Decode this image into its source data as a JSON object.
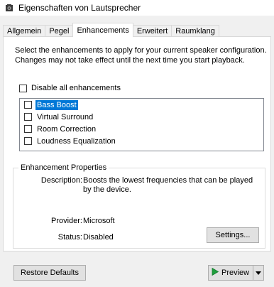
{
  "window": {
    "title": "Eigenschaften von Lautsprecher",
    "icon": "speaker-icon"
  },
  "tabs": [
    {
      "label": "Allgemein",
      "active": false
    },
    {
      "label": "Pegel",
      "active": false
    },
    {
      "label": "Enhancements",
      "active": true
    },
    {
      "label": "Erweitert",
      "active": false
    },
    {
      "label": "Raumklang",
      "active": false
    }
  ],
  "enhancements": {
    "intro": "Select the enhancements to apply for your current speaker configuration. Changes may not take effect until the next time you start playback.",
    "disable_all_label": "Disable all enhancements",
    "disable_all_checked": false,
    "items": [
      {
        "label": "Bass Boost",
        "checked": false,
        "selected": true
      },
      {
        "label": "Virtual Surround",
        "checked": false,
        "selected": false
      },
      {
        "label": "Room Correction",
        "checked": false,
        "selected": false
      },
      {
        "label": "Loudness Equalization",
        "checked": false,
        "selected": false
      }
    ]
  },
  "properties": {
    "legend": "Enhancement Properties",
    "description_label": "Description:",
    "description_value": "Boosts the lowest frequencies that can be played by the device.",
    "provider_label": "Provider:",
    "provider_value": "Microsoft",
    "status_label": "Status:",
    "status_value": "Disabled",
    "settings_button": "Settings..."
  },
  "footer": {
    "restore_defaults": "Restore Defaults",
    "preview": "Preview",
    "preview_icon": "play-icon",
    "dropdown_icon": "chevron-down-icon"
  },
  "colors": {
    "selection": "#0078d7",
    "play": "#1e9e3c"
  }
}
